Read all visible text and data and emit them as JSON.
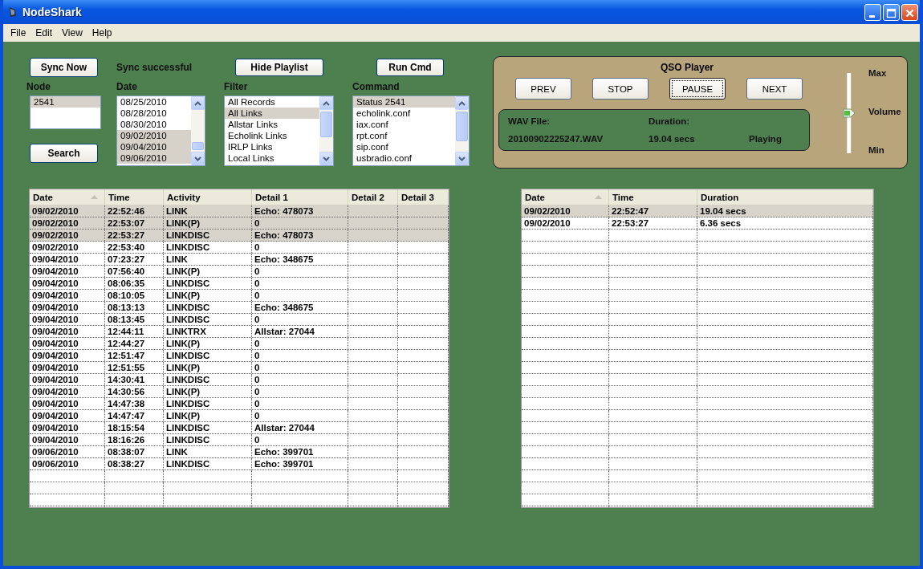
{
  "window": {
    "title": "NodeShark"
  },
  "menu": [
    "File",
    "Edit",
    "View",
    "Help"
  ],
  "sync_button": "Sync Now",
  "sync_status": "Sync successful",
  "hide_playlist_button": "Hide Playlist",
  "run_cmd_button": "Run Cmd",
  "search_button": "Search",
  "lists": [
    {
      "label": "Node",
      "items": [
        {
          "text": "2541",
          "selected": true
        }
      ]
    },
    {
      "label": "Date",
      "scroll": true,
      "items": [
        {
          "text": "08/25/2010",
          "selected": false
        },
        {
          "text": "08/28/2010",
          "selected": false
        },
        {
          "text": "08/30/2010",
          "selected": false
        },
        {
          "text": "09/02/2010",
          "selected": true
        },
        {
          "text": "09/04/2010",
          "selected": true
        },
        {
          "text": "09/06/2010",
          "selected": true
        }
      ]
    },
    {
      "label": "Filter",
      "scroll": true,
      "items": [
        {
          "text": "All Records",
          "selected": false
        },
        {
          "text": "All Links",
          "selected": true
        },
        {
          "text": "Allstar Links",
          "selected": false
        },
        {
          "text": "Echolink Links",
          "selected": false
        },
        {
          "text": "IRLP Links",
          "selected": false
        },
        {
          "text": "Local Links",
          "selected": false
        }
      ]
    },
    {
      "label": "Command",
      "scroll": true,
      "items": [
        {
          "text": "Status 2541",
          "selected": true
        },
        {
          "text": "echolink.conf",
          "selected": false
        },
        {
          "text": "iax.conf",
          "selected": false
        },
        {
          "text": "rpt.conf",
          "selected": false
        },
        {
          "text": "sip.conf",
          "selected": false
        },
        {
          "text": "usbradio.conf",
          "selected": false
        }
      ]
    }
  ],
  "player": {
    "title": "QSO Player",
    "buttons": [
      {
        "label": "PREV",
        "focused": false
      },
      {
        "label": "STOP",
        "focused": false
      },
      {
        "label": "PAUSE",
        "focused": true
      },
      {
        "label": "NEXT",
        "focused": false
      }
    ],
    "wav_label": "WAV File:",
    "wav_value": "20100902225247.WAV",
    "duration_label": "Duration:",
    "duration_value": "19.04 secs",
    "status": "Playing",
    "volume": {
      "max": "Max",
      "label": "Volume",
      "min": "Min",
      "level": 0.5
    }
  },
  "log_table": {
    "columns": [
      {
        "label": "Date",
        "sorted": true
      },
      {
        "label": "Time",
        "sorted": false
      },
      {
        "label": "Activity",
        "sorted": false
      },
      {
        "label": "Detail 1",
        "sorted": false
      },
      {
        "label": "Detail 2",
        "sorted": false
      },
      {
        "label": "Detail 3",
        "sorted": false
      }
    ],
    "rows": [
      {
        "cells": [
          "09/02/2010",
          "22:52:46",
          "LINK",
          "Echo: 478073"
        ],
        "selected": true
      },
      {
        "cells": [
          "09/02/2010",
          "22:53:07",
          "LINK(P)",
          "0"
        ],
        "selected": true
      },
      {
        "cells": [
          "09/02/2010",
          "22:53:27",
          "LINKDISC",
          "Echo: 478073"
        ],
        "selected": true
      },
      {
        "cells": [
          "09/02/2010",
          "22:53:40",
          "LINKDISC",
          "0"
        ],
        "selected": false
      },
      {
        "cells": [
          "09/04/2010",
          "07:23:27",
          "LINK",
          "Echo: 348675"
        ],
        "selected": false
      },
      {
        "cells": [
          "09/04/2010",
          "07:56:40",
          "LINK(P)",
          "0"
        ],
        "selected": false
      },
      {
        "cells": [
          "09/04/2010",
          "08:06:35",
          "LINKDISC",
          "0"
        ],
        "selected": false
      },
      {
        "cells": [
          "09/04/2010",
          "08:10:05",
          "LINK(P)",
          "0"
        ],
        "selected": false
      },
      {
        "cells": [
          "09/04/2010",
          "08:13:13",
          "LINKDISC",
          "Echo: 348675"
        ],
        "selected": false
      },
      {
        "cells": [
          "09/04/2010",
          "08:13:45",
          "LINKDISC",
          "0"
        ],
        "selected": false
      },
      {
        "cells": [
          "09/04/2010",
          "12:44:11",
          "LINKTRX",
          "Allstar: 27044"
        ],
        "selected": false
      },
      {
        "cells": [
          "09/04/2010",
          "12:44:27",
          "LINK(P)",
          "0"
        ],
        "selected": false
      },
      {
        "cells": [
          "09/04/2010",
          "12:51:47",
          "LINKDISC",
          "0"
        ],
        "selected": false
      },
      {
        "cells": [
          "09/04/2010",
          "12:51:55",
          "LINK(P)",
          "0"
        ],
        "selected": false
      },
      {
        "cells": [
          "09/04/2010",
          "14:30:41",
          "LINKDISC",
          "0"
        ],
        "selected": false
      },
      {
        "cells": [
          "09/04/2010",
          "14:30:56",
          "LINK(P)",
          "0"
        ],
        "selected": false
      },
      {
        "cells": [
          "09/04/2010",
          "14:47:38",
          "LINKDISC",
          "0"
        ],
        "selected": false
      },
      {
        "cells": [
          "09/04/2010",
          "14:47:47",
          "LINK(P)",
          "0"
        ],
        "selected": false
      },
      {
        "cells": [
          "09/04/2010",
          "18:15:54",
          "LINKDISC",
          "Allstar: 27044"
        ],
        "selected": false
      },
      {
        "cells": [
          "09/04/2010",
          "18:16:26",
          "LINKDISC",
          "0"
        ],
        "selected": false
      },
      {
        "cells": [
          "09/06/2010",
          "08:38:07",
          "LINK",
          "Echo: 399701"
        ],
        "selected": false
      },
      {
        "cells": [
          "09/06/2010",
          "08:38:27",
          "LINKDISC",
          "Echo: 399701"
        ],
        "selected": false
      }
    ]
  },
  "playlist_table": {
    "columns": [
      {
        "label": "Date",
        "sorted": true
      },
      {
        "label": "Time",
        "sorted": false
      },
      {
        "label": "Duration",
        "sorted": false
      }
    ],
    "rows": [
      {
        "cells": [
          "09/02/2010",
          "22:52:47",
          "19.04 secs"
        ],
        "selected": true
      },
      {
        "cells": [
          "09/02/2010",
          "22:53:27",
          "6.36 secs"
        ],
        "selected": false
      }
    ]
  }
}
